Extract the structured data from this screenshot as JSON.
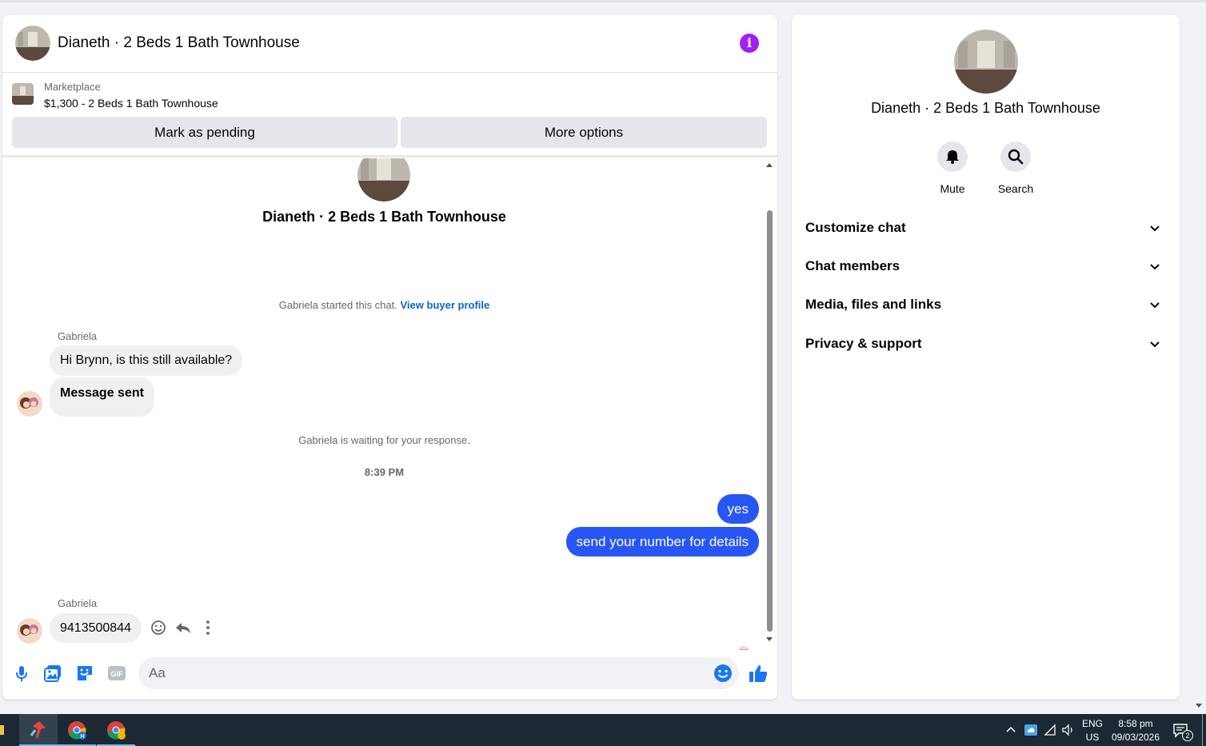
{
  "chat": {
    "title": "Dianeth · 2 Beds 1 Bath Townhouse",
    "listing_source": "Marketplace",
    "listing_title": "$1,300 - 2 Beds 1 Bath Townhouse",
    "mark_pending_label": "Mark as pending",
    "more_options_label": "More options",
    "intro_title": "Dianeth · 2 Beds 1 Bath Townhouse",
    "started_text": "Gabriela started this chat.",
    "view_buyer_label": "View buyer profile",
    "messages": [
      {
        "sender": "Gabriela",
        "text": "Hi Brynn, is this still available?"
      },
      {
        "text": "Message sent"
      },
      {
        "text": "yes"
      },
      {
        "text": "send your number for details"
      },
      {
        "sender": "Gabriela",
        "text": "9413500844"
      }
    ],
    "waiting_text": "Gabriela is waiting for your response.",
    "timestamp": "8:39 PM",
    "composer_placeholder": "Aa"
  },
  "side": {
    "title": "Dianeth · 2 Beds 1 Bath Townhouse",
    "mute_label": "Mute",
    "search_label": "Search",
    "sections": [
      "Customize chat",
      "Chat members",
      "Media, files and links",
      "Privacy & support"
    ]
  },
  "taskbar": {
    "lang": "ENG",
    "region": "US",
    "time": "8:58 pm",
    "date": "09/03/2026",
    "notification_count": "2"
  },
  "colors": {
    "accent": "#2756f5",
    "link": "#0a66c2",
    "info": "#a020f0"
  }
}
